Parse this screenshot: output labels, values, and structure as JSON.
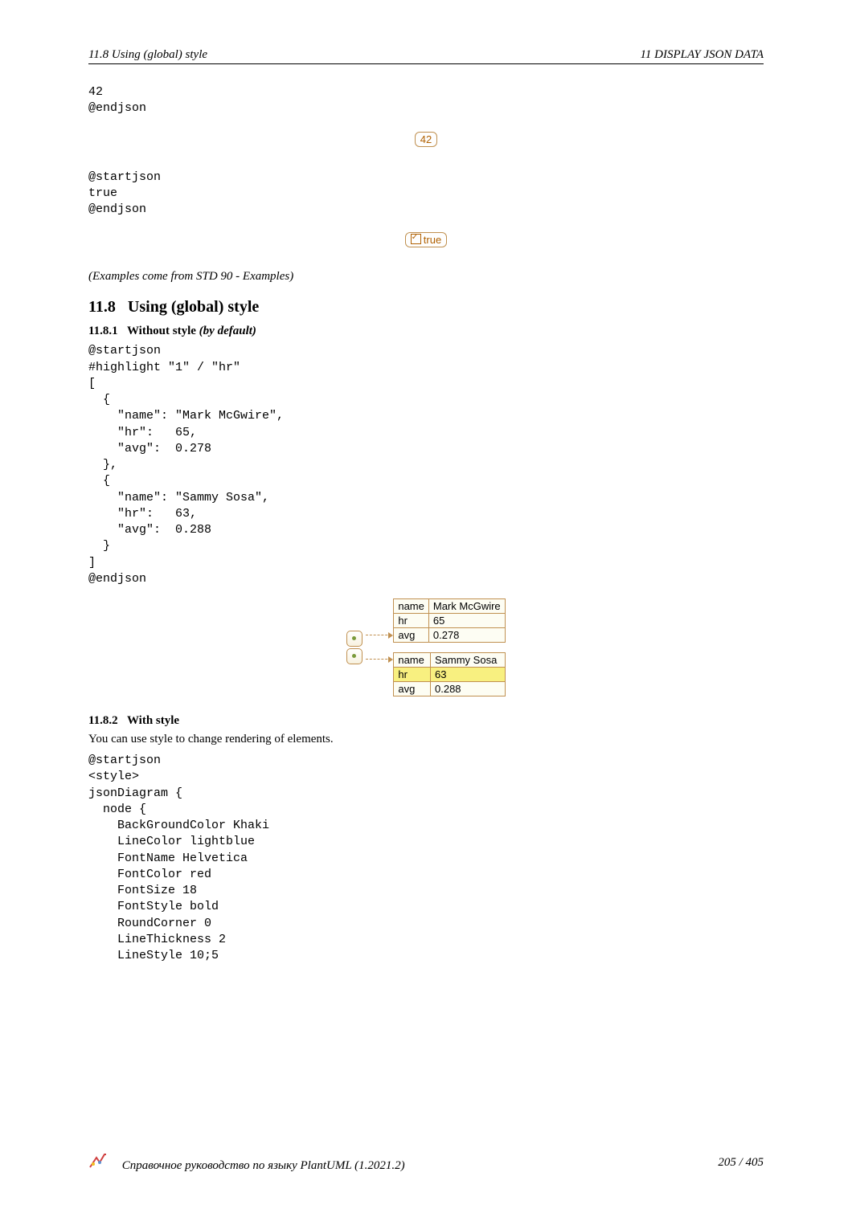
{
  "header": {
    "left": "11.8    Using (global) style",
    "right": "11    DISPLAY JSON DATA"
  },
  "top_code_a": "42\n@endjson",
  "box42": "42",
  "top_code_b": "@startjson\ntrue\n@endjson",
  "box_true": "true",
  "examples_note": "(Examples come from STD 90 - Examples)",
  "sec_11_8": {
    "number": "11.8",
    "title": "Using (global) style"
  },
  "sec_11_8_1": {
    "number": "11.8.1",
    "title": "Without style",
    "suffix": "(by default)"
  },
  "code_11_8_1": "@startjson\n#highlight \"1\" / \"hr\"\n[\n  {\n    \"name\": \"Mark McGwire\",\n    \"hr\":   65,\n    \"avg\":  0.278\n  },\n  {\n    \"name\": \"Sammy Sosa\",\n    \"hr\":   63,\n    \"avg\":  0.288\n  }\n]\n@endjson",
  "chart_data": {
    "type": "table",
    "tables": [
      {
        "rows": [
          {
            "key": "name",
            "value": "Mark McGwire",
            "highlight": false
          },
          {
            "key": "hr",
            "value": "65",
            "highlight": false
          },
          {
            "key": "avg",
            "value": "0.278",
            "highlight": false
          }
        ]
      },
      {
        "rows": [
          {
            "key": "name",
            "value": "Sammy Sosa",
            "highlight": false
          },
          {
            "key": "hr",
            "value": "63",
            "highlight": true
          },
          {
            "key": "avg",
            "value": "0.288",
            "highlight": false
          }
        ]
      }
    ]
  },
  "sec_11_8_2": {
    "number": "11.8.2",
    "title": "With style"
  },
  "with_style_text": "You can use style to change rendering of elements.",
  "code_11_8_2": "@startjson\n<style>\njsonDiagram {\n  node {\n    BackGroundColor Khaki\n    LineColor lightblue\n    FontName Helvetica\n    FontColor red\n    FontSize 18\n    FontStyle bold\n    RoundCorner 0\n    LineThickness 2\n    LineStyle 10;5",
  "footer": {
    "title": "Справочное руководство по языку PlantUML (1.2021.2)",
    "page": "205 / 405"
  }
}
